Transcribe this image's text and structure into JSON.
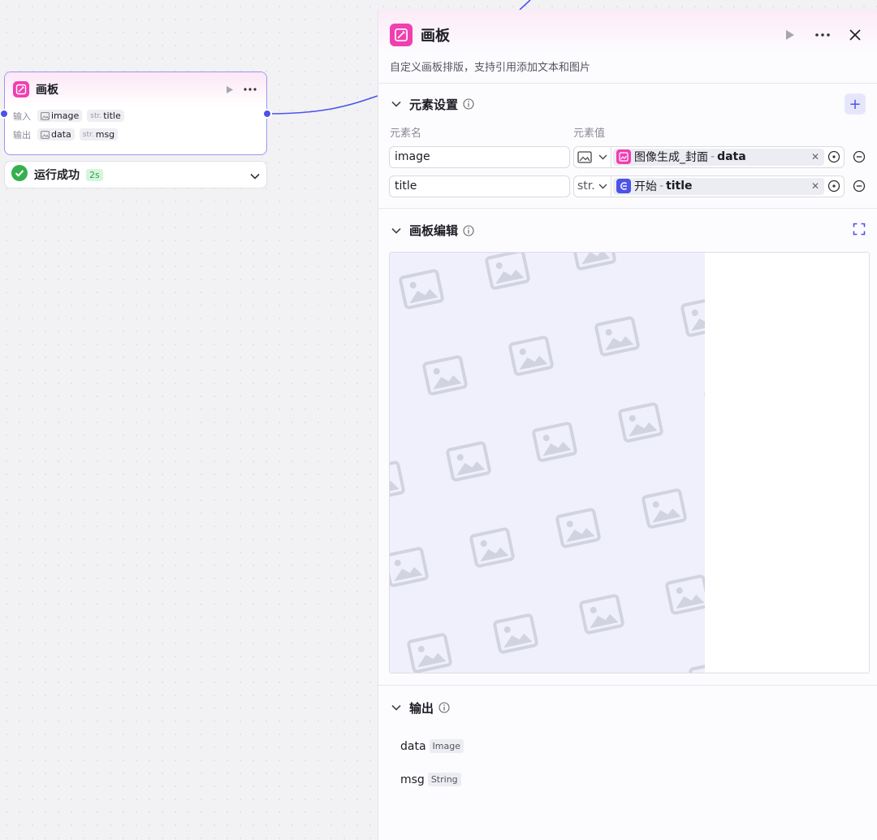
{
  "node": {
    "title": "画板",
    "input_label": "输入",
    "output_label": "输出",
    "inputs": [
      {
        "kind": "image",
        "name": "image"
      },
      {
        "kind": "str",
        "prefix": "str.",
        "name": "title"
      }
    ],
    "outputs": [
      {
        "kind": "image",
        "name": "data"
      },
      {
        "kind": "str",
        "prefix": "str.",
        "name": "msg"
      }
    ],
    "icon": "canvas-pen-icon",
    "accent": "#f03fb0"
  },
  "status": {
    "text": "运行成功",
    "time": "2s",
    "color": "#2aa24a"
  },
  "panel": {
    "title": "画板",
    "description": "自定义画板排版，支持引用添加文本和图片",
    "elements": {
      "title": "元素设置",
      "col_name": "元素名",
      "col_value": "元素值",
      "add_label": "+",
      "rows": [
        {
          "name": "image",
          "type_icon": "image-icon",
          "type_label": "",
          "ref_icon": "image-gen-icon",
          "ref_color": "#f03fb0",
          "ref_node": "图像生成_封面",
          "ref_sep": "-",
          "ref_field": "data"
        },
        {
          "name": "title",
          "type_icon": "",
          "type_label": "str.",
          "ref_icon": "start-icon",
          "ref_color": "#4d53e8",
          "ref_node": "开始",
          "ref_sep": "-",
          "ref_field": "title"
        }
      ]
    },
    "editor": {
      "title": "画板编辑"
    },
    "output": {
      "title": "输出",
      "fields": [
        {
          "name": "data",
          "type": "Image"
        },
        {
          "name": "msg",
          "type": "String"
        }
      ]
    }
  },
  "colors": {
    "brand": "#4d53e8",
    "node_border": "#9b96f2",
    "canvas_bg": "#f2f2f5"
  }
}
